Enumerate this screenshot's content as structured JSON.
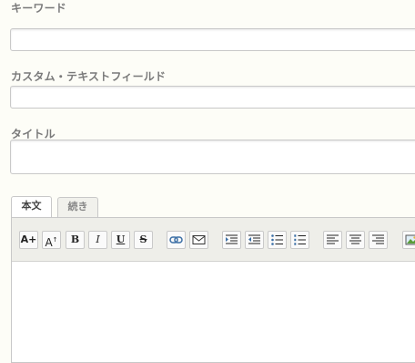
{
  "fields": {
    "keyword": {
      "label": "キーワード",
      "value": ""
    },
    "custom_text": {
      "label": "カスタム・テキストフィールド",
      "value": ""
    },
    "title": {
      "label": "タイトル",
      "value": ""
    }
  },
  "editor": {
    "tabs": [
      {
        "label": "本文",
        "active": true
      },
      {
        "label": "続き",
        "active": false
      }
    ],
    "toolbar": {
      "font_increase": "A+",
      "font_superscript": "A",
      "bold": "B",
      "italic": "I",
      "underline": "U",
      "strikethrough": "S",
      "icons": [
        "font-size-increase-icon",
        "font-size-up-icon",
        "bold-icon",
        "italic-icon",
        "underline-icon",
        "strikethrough-icon",
        "link-icon",
        "email-icon",
        "indent-icon",
        "outdent-icon",
        "bulleted-list-icon",
        "numbered-list-icon",
        "align-left-icon",
        "align-center-icon",
        "align-right-icon",
        "insert-image-icon"
      ]
    },
    "body": ""
  }
}
